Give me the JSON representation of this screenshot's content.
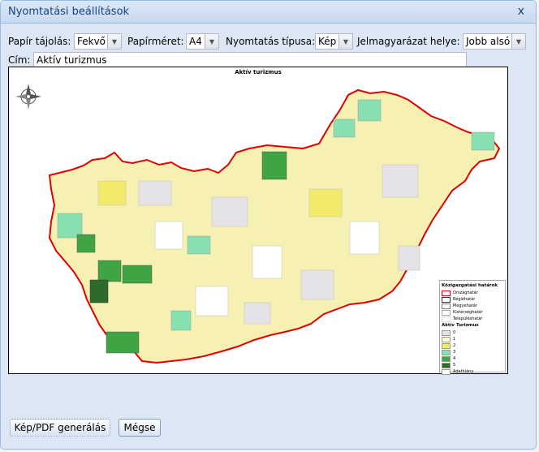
{
  "dialog": {
    "title": "Nyomtatási beállítások",
    "close_glyph": "x"
  },
  "settings": {
    "orientation_label": "Papír tájolás:",
    "orientation_value": "Fekvő",
    "paper_size_label": "Papírméret:",
    "paper_size_value": "A4",
    "print_type_label": "Nyomtatás típusa:",
    "print_type_value": "Kép",
    "legend_pos_label": "Jelmagyarázat helye:",
    "legend_pos_value": "Jobb alsó",
    "title_label": "Cím:",
    "title_value": "Aktív turizmus"
  },
  "map": {
    "title": "Aktív turizmus",
    "compass_icon": "compass-rose-icon",
    "legend": {
      "boundaries_heading": "Közigazgatási határok",
      "boundaries": [
        {
          "label": "Országhatár",
          "color": "#ffffff",
          "border": "#e00000"
        },
        {
          "label": "Régióhatár",
          "color": "#ffffff",
          "border": "#333333"
        },
        {
          "label": "Megyehatár",
          "color": "#ffffff",
          "border": "#777777"
        },
        {
          "label": "Kistérséghatár",
          "color": "#ffffff",
          "border": "#aaaaaa"
        },
        {
          "label": "Településhatár",
          "color": "#ffffff",
          "border": "#dddddd"
        }
      ],
      "classes_heading": "Aktív Turizmus",
      "classes": [
        {
          "label": "0",
          "color": "#e6e3e8"
        },
        {
          "label": "1",
          "color": "#fffbd0"
        },
        {
          "label": "2",
          "color": "#f2ea6a"
        },
        {
          "label": "3",
          "color": "#86e0b0"
        },
        {
          "label": "4",
          "color": "#3fa544"
        },
        {
          "label": "5",
          "color": "#2e6b2a"
        },
        {
          "label": "Adathiány",
          "color": "#ffffff"
        }
      ]
    }
  },
  "buttons": {
    "generate": "Kép/PDF generálás",
    "cancel": "Mégse"
  }
}
